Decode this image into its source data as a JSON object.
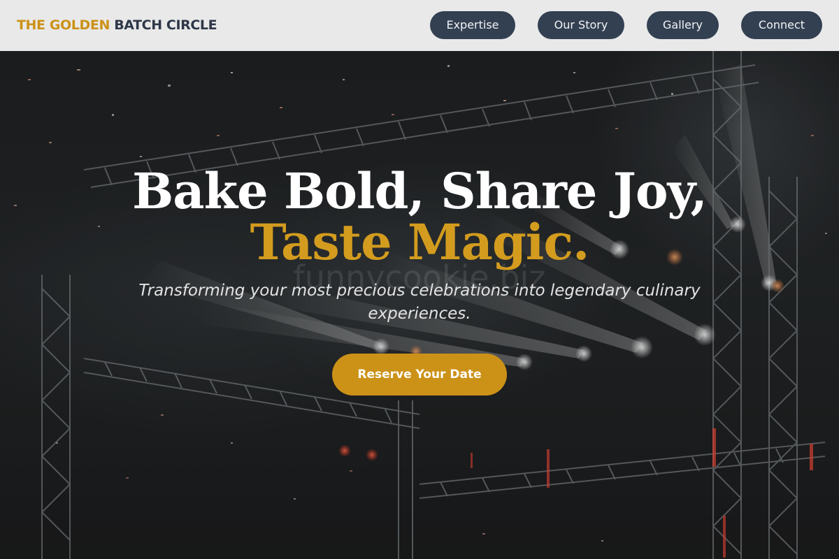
{
  "header": {
    "brand_accent": "THE GOLDEN",
    "brand_main": "BATCH CIRCLE",
    "nav": [
      {
        "label": "Expertise"
      },
      {
        "label": "Our Story"
      },
      {
        "label": "Gallery"
      },
      {
        "label": "Connect"
      }
    ]
  },
  "hero": {
    "headline_line1": "Bake Bold, Share Joy,",
    "headline_line2": "Taste Magic.",
    "watermark": "funnycookie.biz",
    "subtitle": "Transforming your most precious celebrations into legendary culinary experiences.",
    "cta_label": "Reserve Your Date"
  },
  "colors": {
    "accent": "#cc9218",
    "nav_button_bg": "#334052",
    "header_bg": "#e9e9e9",
    "brand_dark": "#2e3748"
  }
}
